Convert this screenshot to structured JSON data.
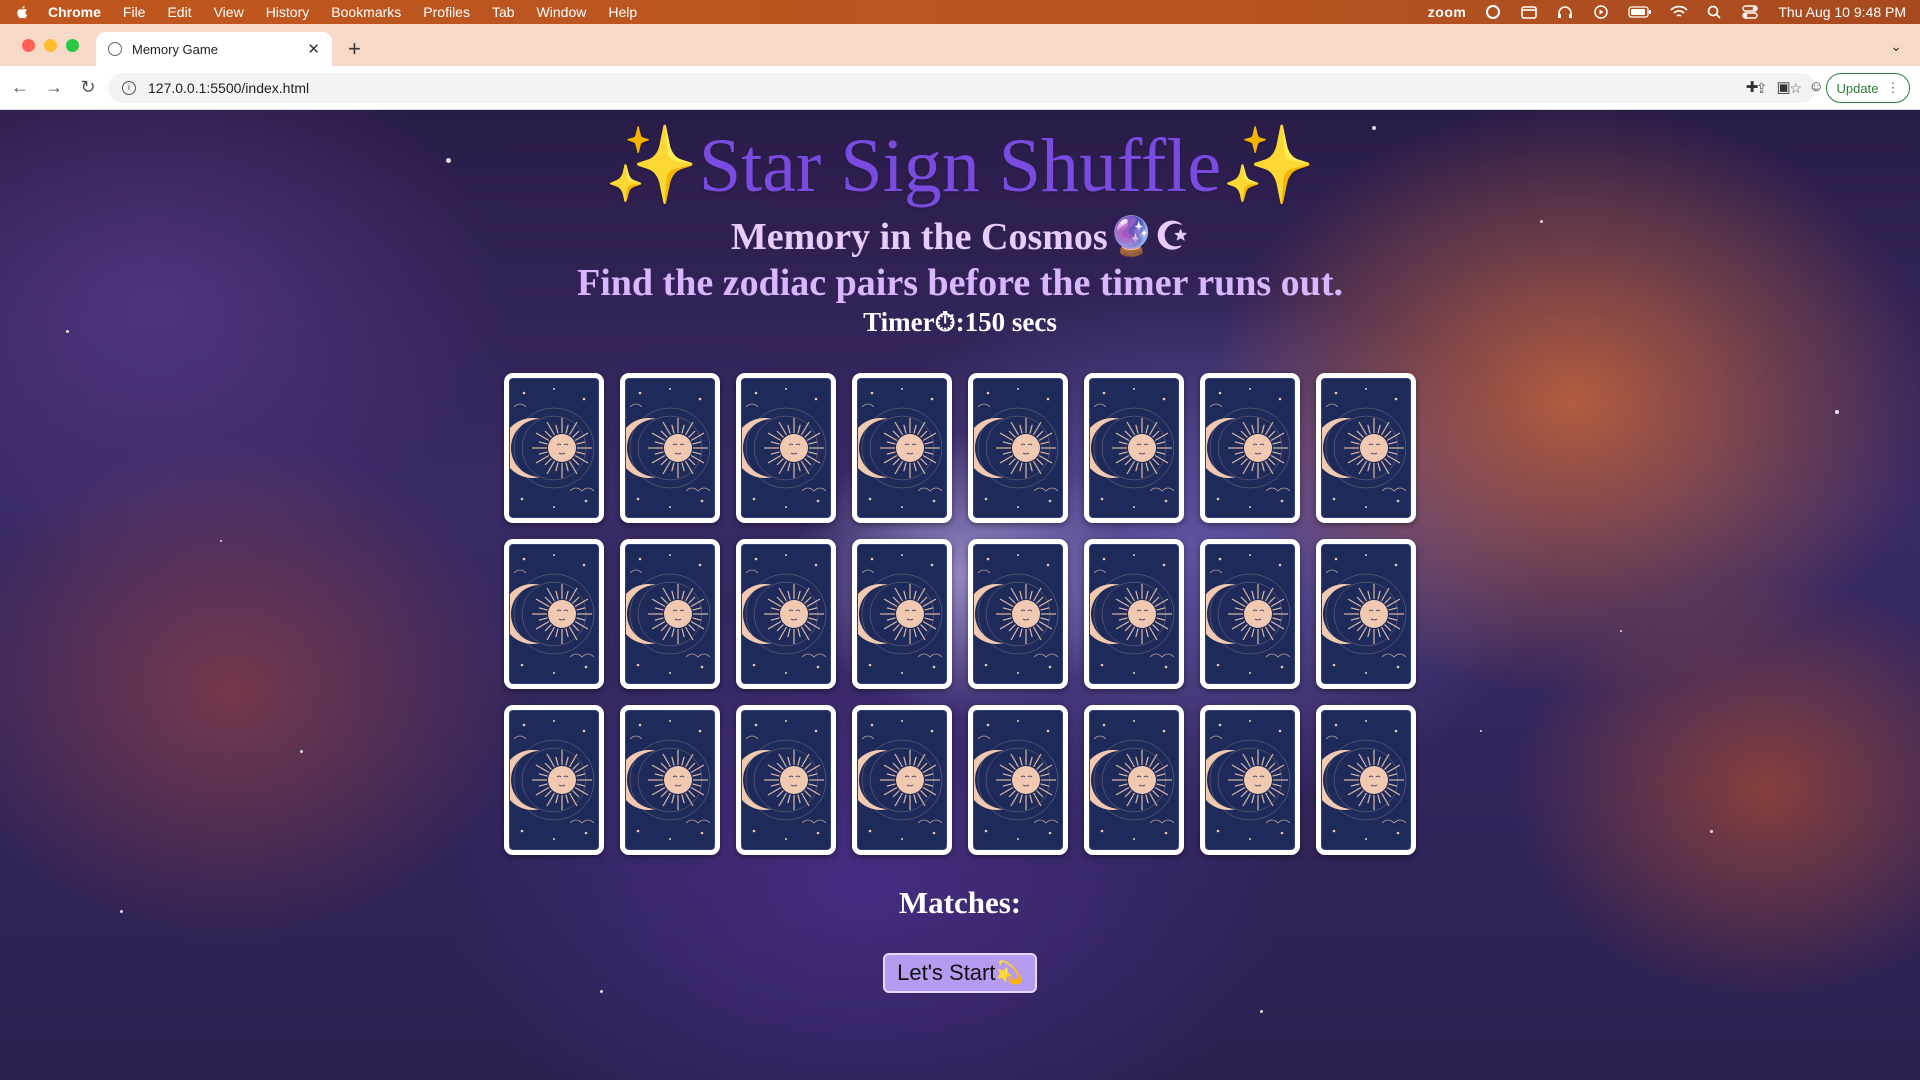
{
  "menubar": {
    "app_name": "Chrome",
    "items": [
      "File",
      "Edit",
      "View",
      "History",
      "Bookmarks",
      "Profiles",
      "Tab",
      "Window",
      "Help"
    ],
    "zoom_label": "zoom",
    "clock": "Thu Aug 10  9:48 PM"
  },
  "browser": {
    "tab_title": "Memory Game",
    "url": "127.0.0.1:5500/index.html",
    "update_label": "Update"
  },
  "game": {
    "title": "✨Star Sign Shuffle✨",
    "subtitle": "Memory in the Cosmos🔮☪",
    "instruction": "Find the zodiac pairs before the timer runs out.",
    "timer_label": "Timer⏱:150 secs",
    "matches_label": "Matches:",
    "start_button": "Let's Start💫",
    "card_rows": 3,
    "card_columns": 8,
    "card_back_icon": "sun-moon-tarot-icon",
    "colors": {
      "title": "#7a4be0",
      "subtitle": "#e8ccff",
      "card_back": "#1e2a5a",
      "card_art": "#f1c9b0",
      "button": "#b59cf0"
    }
  }
}
